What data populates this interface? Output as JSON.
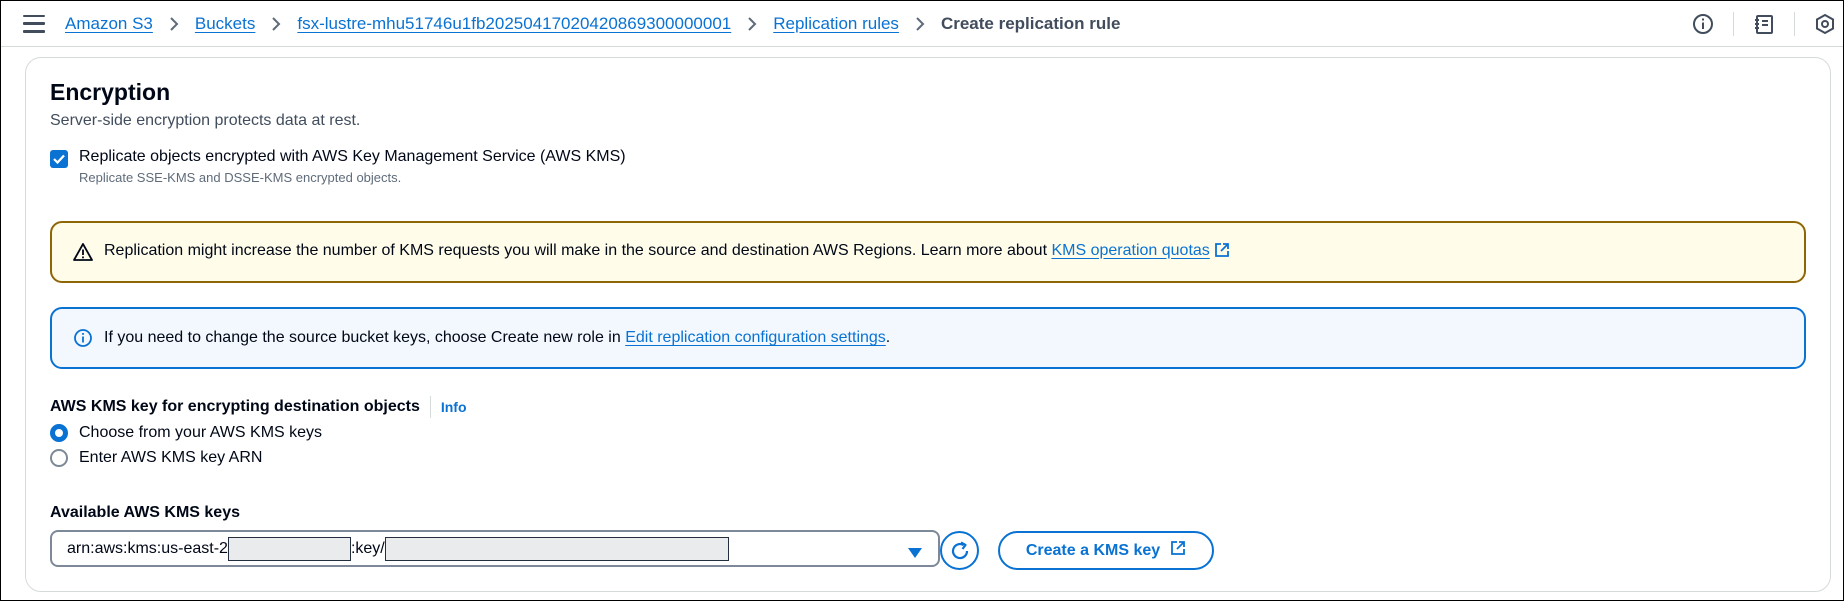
{
  "breadcrumb": {
    "items": [
      "Amazon S3",
      "Buckets",
      "fsx-lustre-mhu51746u1fb20250417020420869300000001",
      "Replication rules"
    ],
    "current": "Create replication rule"
  },
  "top_icons": [
    "info-icon",
    "notes-icon",
    "settings-icon"
  ],
  "encryption": {
    "title": "Encryption",
    "description": "Server-side encryption protects data at rest.",
    "checkbox": {
      "checked": true,
      "label": "Replicate objects encrypted with AWS Key Management Service (AWS KMS)",
      "sublabel": "Replicate SSE-KMS and DSSE-KMS encrypted objects."
    },
    "warning": {
      "text": "Replication might increase the number of KMS requests you will make in the source and destination AWS Regions. Learn more about ",
      "link": "KMS operation quotas"
    },
    "info_alert": {
      "text": "If you need to change the source bucket keys, choose Create new role in ",
      "link": "Edit replication configuration settings",
      "suffix": "."
    },
    "kms_key": {
      "label": "AWS KMS key for encrypting destination objects",
      "info": "Info",
      "options": [
        "Choose from your AWS KMS keys",
        "Enter AWS KMS key ARN"
      ],
      "selected": "Choose from your AWS KMS keys"
    },
    "available": {
      "label": "Available AWS KMS keys",
      "value_prefix": "arn:aws:kms:us-east-2",
      "value_mid": ":key/",
      "create_button": "Create a KMS key"
    }
  },
  "colors": {
    "link": "#0972d3",
    "warning_border": "#8d6605",
    "warning_bg": "#fffce9",
    "info_bg": "#f2f8fd"
  }
}
